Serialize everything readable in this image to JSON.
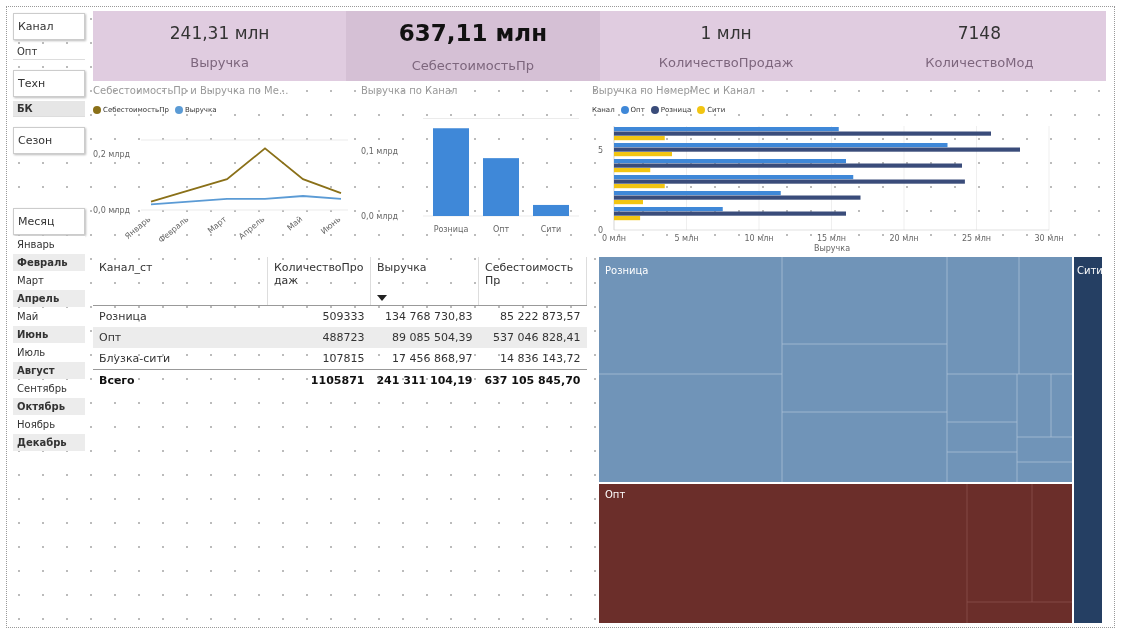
{
  "slicers": [
    {
      "title": "Канал",
      "items": [
        {
          "label": "Опт",
          "selected": false
        }
      ]
    },
    {
      "title": "Техн",
      "items": [
        {
          "label": "БК",
          "selected": true
        }
      ]
    },
    {
      "title": "Сезон"
    }
  ],
  "month_slicer": {
    "title": "Месяц",
    "items": [
      {
        "label": "Январь",
        "selected": false
      },
      {
        "label": "Февраль",
        "selected": true
      },
      {
        "label": "Март",
        "selected": false
      },
      {
        "label": "Апрель",
        "selected": true
      },
      {
        "label": "Май",
        "selected": false
      },
      {
        "label": "Июнь",
        "selected": true
      },
      {
        "label": "Июль",
        "selected": false
      },
      {
        "label": "Август",
        "selected": true
      },
      {
        "label": "Сентябрь",
        "selected": false
      },
      {
        "label": "Октябрь",
        "selected": true
      },
      {
        "label": "Ноябрь",
        "selected": false
      },
      {
        "label": "Декабрь",
        "selected": true
      }
    ]
  },
  "kpis": [
    {
      "value": "241,31 млн",
      "label": "Выручка",
      "selected": false
    },
    {
      "value": "637,11 млн",
      "label": "СебестоимостьПр",
      "selected": true
    },
    {
      "value": "1 млн",
      "label": "КоличествоПродаж",
      "selected": false
    },
    {
      "value": "7148",
      "label": "КоличествоМод",
      "selected": false
    }
  ],
  "line_chart": {
    "chart_data": {
      "type": "line",
      "title": "СебестоимостьПр и Выручка по Ме...",
      "legend": true,
      "categories": [
        "Январь",
        "Февраль",
        "Март",
        "Апрель",
        "Май",
        "Июнь"
      ],
      "ylim": [
        0,
        0.25
      ],
      "yticks": [
        {
          "value": 0,
          "label": "0,0 млрд"
        },
        {
          "value": 0.2,
          "label": "0,2 млрд"
        }
      ],
      "series": [
        {
          "name": "СебестоимостьПр",
          "color": "#8a7018",
          "values": [
            0.03,
            0.07,
            0.11,
            0.22,
            0.11,
            0.06
          ]
        },
        {
          "name": "Выручка",
          "color": "#5b9bd5",
          "values": [
            0.02,
            0.03,
            0.04,
            0.04,
            0.05,
            0.04
          ]
        }
      ]
    }
  },
  "column_chart": {
    "chart_data": {
      "type": "bar",
      "title": "Выручка по Канал",
      "categories": [
        "Розница",
        "Опт",
        "Сити"
      ],
      "values": [
        0.135,
        0.089,
        0.017
      ],
      "ylim": [
        0,
        0.15
      ],
      "yticks": [
        {
          "value": 0,
          "label": "0,0 млрд"
        },
        {
          "value": 0.1,
          "label": "0,1 млрд"
        }
      ],
      "color": "#3f88d8"
    }
  },
  "bar_chart": {
    "chart_data": {
      "type": "bar",
      "orientation": "horizontal",
      "title": "Выручка по НомерМес и Канал",
      "legend": {
        "title": "Канал"
      },
      "grid": true,
      "xlabel": "Выручка",
      "x": [
        6,
        5,
        4,
        3,
        2,
        1
      ],
      "xlim": [
        0,
        30
      ],
      "ylim": [
        0,
        6.5
      ],
      "xticks": [
        {
          "value": 0,
          "label": "0 млн"
        },
        {
          "value": 5,
          "label": "5 млн"
        },
        {
          "value": 10,
          "label": "10 млн"
        },
        {
          "value": 15,
          "label": "15 млн"
        },
        {
          "value": 20,
          "label": "20 млн"
        },
        {
          "value": 25,
          "label": "25 млн"
        },
        {
          "value": 30,
          "label": "30 млн"
        }
      ],
      "yticks": [
        {
          "value": 0,
          "label": "0"
        },
        {
          "value": 5,
          "label": "5"
        }
      ],
      "series": [
        {
          "name": "Опт",
          "color": "#3f88d8",
          "values": [
            15.5,
            23,
            16,
            16.5,
            11.5,
            7.5
          ]
        },
        {
          "name": "Розница",
          "color": "#3a4c7a",
          "values": [
            26,
            28,
            24,
            24.2,
            17,
            16
          ]
        },
        {
          "name": "Сити",
          "color": "#f2c512",
          "values": [
            3.5,
            4,
            2.5,
            3.5,
            2,
            1.8
          ]
        }
      ]
    }
  },
  "table": {
    "columns": [
      {
        "label": "Канал_ст",
        "sorted": false
      },
      {
        "label": "КоличествоПродаж",
        "sorted": false
      },
      {
        "label": "Выручка",
        "sorted": true
      },
      {
        "label": "СебестоимостьПр",
        "sorted": false
      }
    ],
    "rows": [
      [
        "Розница",
        "509333",
        "134 768 730,83",
        "85 222 873,57"
      ],
      [
        "Опт",
        "488723",
        "89 085 504,39",
        "537 046 828,41"
      ],
      [
        "Блузка-сити",
        "107815",
        "17 456 868,97",
        "14 836 143,72"
      ]
    ],
    "total": [
      "Всего",
      "1105871",
      "241 311 104,19",
      "637 105 845,70"
    ]
  },
  "treemap": {
    "groups": [
      {
        "label": "Розница",
        "color": "#7094b8"
      },
      {
        "label": "Опт",
        "color": "#6b2e2a"
      },
      {
        "label": "Сити",
        "color": "#253f63"
      }
    ]
  }
}
